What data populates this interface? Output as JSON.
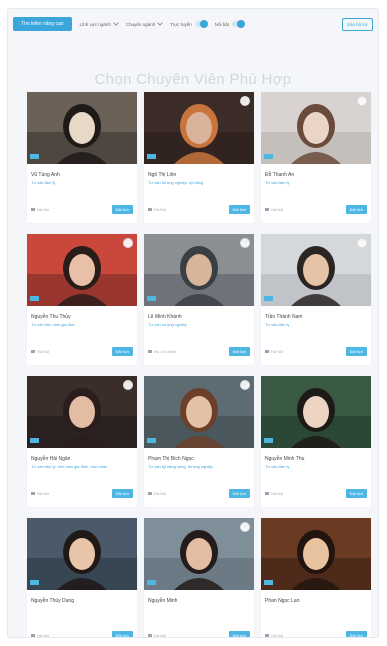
{
  "filters": {
    "primary_button": "Tìm kiếm nâng cao",
    "dropdowns": [
      "Lĩnh vực ngành",
      "Chuyên ngành"
    ],
    "toggles": [
      "Trực tuyến",
      "Nổi bật"
    ],
    "reset_label": "Xóa bộ lọc"
  },
  "page_title": "Chọn Chuyên Viên Phù Hợp",
  "book_label": "Đặt lịch",
  "accent_color": "#3aa6d9",
  "tutors": [
    {
      "name": "Vũ Tùng Anh",
      "skills": "Tư vấn tâm lý",
      "meta": "Hà Nội",
      "favorite": false,
      "palette": [
        "#6b6157",
        "#3a3530",
        "#e8d8c8",
        "#1e1a18"
      ]
    },
    {
      "name": "Ngô Thị Liên",
      "skills": "Tư vấn hướng nghiệp, kỹ năng",
      "meta": "Hà Nội",
      "favorite": true,
      "palette": [
        "#3b2c28",
        "#2a1e1b",
        "#d9b49a",
        "#c8743c"
      ]
    },
    {
      "name": "Đỗ Thanh An",
      "skills": "Tư vấn tâm lý",
      "meta": "Hà Nội",
      "favorite": true,
      "palette": [
        "#d8d3d0",
        "#b9b2ad",
        "#e9d4c6",
        "#6a4a3a"
      ]
    },
    {
      "name": "Nguyễn Thu Thủy",
      "skills": "Tư vấn tình cảm gia đình",
      "meta": "Hà Nội",
      "favorite": true,
      "palette": [
        "#c9483b",
        "#7a2d28",
        "#e8c0a8",
        "#2a1c18"
      ]
    },
    {
      "name": "Lê Minh Khánh",
      "skills": "Tư vấn hướng nghiệp",
      "meta": "Hồ Chí Minh",
      "favorite": true,
      "palette": [
        "#8a8f94",
        "#5c6167",
        "#d8b49a",
        "#3a3f44"
      ]
    },
    {
      "name": "Trần Thành Nam",
      "skills": "Tư vấn tâm lý",
      "meta": "Hà Nội",
      "favorite": true,
      "palette": [
        "#d5d8da",
        "#b2b6ba",
        "#e6c2a6",
        "#2a2422"
      ]
    },
    {
      "name": "Nguyễn Hải Ngân",
      "skills": "Tư vấn tâm lý, tình cảm gia đình, hôn nhân",
      "meta": "Hà Nội",
      "favorite": true,
      "palette": [
        "#3a2d2a",
        "#22191a",
        "#e2bca3",
        "#2a1e1c"
      ]
    },
    {
      "name": "Phạm Thị Bích Ngọc",
      "skills": "Tư vấn kỹ năng sống, hướng nghiệp",
      "meta": "Hà Nội",
      "favorite": true,
      "palette": [
        "#5c6c72",
        "#3e4a4f",
        "#e4c1a6",
        "#6b3f2a"
      ]
    },
    {
      "name": "Nguyễn Minh Thu",
      "skills": "Tư vấn tâm lý",
      "meta": "Hà Nội",
      "favorite": false,
      "palette": [
        "#3a5a44",
        "#223a2c",
        "#ecd3c2",
        "#1d1a18"
      ]
    },
    {
      "name": "Nguyễn Thùy Dung",
      "skills": "",
      "meta": "Hà Nội",
      "favorite": false,
      "palette": [
        "#4a5a6a",
        "#2c3845",
        "#e8c4a8",
        "#1e1816"
      ]
    },
    {
      "name": "Nguyễn Minh",
      "skills": "",
      "meta": "Hà Nội",
      "favorite": true,
      "palette": [
        "#7f8f9a",
        "#5e6c76",
        "#e3bda2",
        "#231c1a"
      ]
    },
    {
      "name": "Phan Ngọc Lan",
      "skills": "",
      "meta": "Hà Nội",
      "favorite": false,
      "palette": [
        "#6a3a22",
        "#3c2015",
        "#e9c2a0",
        "#22150f"
      ]
    }
  ]
}
